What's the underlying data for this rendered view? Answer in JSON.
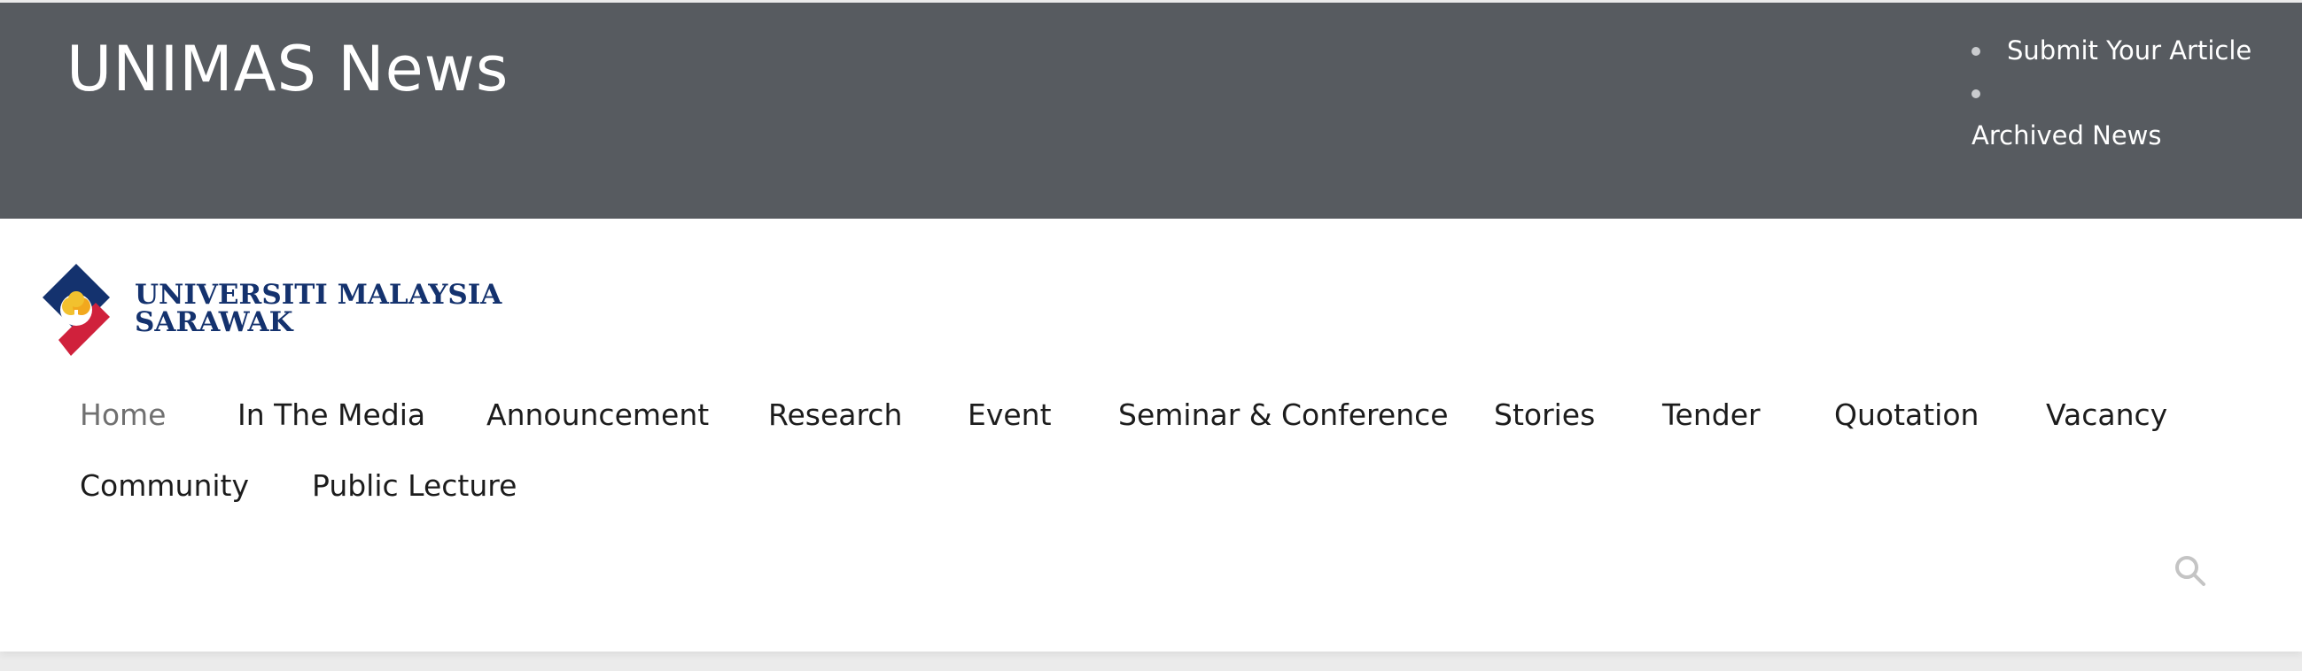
{
  "topbar": {
    "site_title": "UNIMAS News",
    "links": [
      {
        "label": "Submit Your Article"
      },
      {
        "label": ""
      },
      {
        "label": "Archived News"
      }
    ]
  },
  "logo": {
    "line1": "UNIVERSITI MALAYSIA",
    "line2": "SARAWAK"
  },
  "nav": {
    "active": "Home",
    "items": [
      {
        "label": "Home"
      },
      {
        "label": "In The Media"
      },
      {
        "label": "Announcement"
      },
      {
        "label": "Research"
      },
      {
        "label": "Event"
      },
      {
        "label": "Seminar & Conference"
      },
      {
        "label": "Stories"
      },
      {
        "label": "Tender"
      },
      {
        "label": "Quotation"
      },
      {
        "label": "Vacancy"
      },
      {
        "label": "Community"
      },
      {
        "label": "Public Lecture"
      }
    ]
  },
  "search": {
    "icon": "search-icon"
  },
  "colors": {
    "topbar_bg": "#575b60",
    "brand_navy": "#14326e",
    "brand_red": "#d0213c",
    "brand_yellow": "#f2c12e",
    "nav_text": "#1c1c1c",
    "nav_active": "#707070"
  }
}
